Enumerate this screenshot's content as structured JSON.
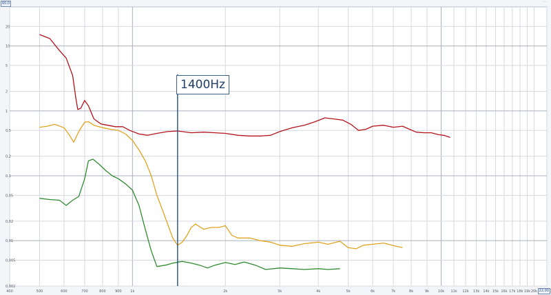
{
  "corners": {
    "top_left": "60,0",
    "bottom_right": "22,00"
  },
  "window_dots": "···",
  "marker": {
    "label": "1400Hz",
    "freq": 1400,
    "color": "#1f4e8c"
  },
  "chart_data": {
    "type": "line",
    "title": "",
    "xlabel": "",
    "ylabel": "",
    "x_scale": "log",
    "y_scale": "log",
    "xlim": [
      400,
      22000
    ],
    "ylim": [
      0.002,
      40
    ],
    "grid": true,
    "legend": "none",
    "x_ticks": [
      {
        "v": 400,
        "label": "400"
      },
      {
        "v": 500,
        "label": "500"
      },
      {
        "v": 600,
        "label": "600"
      },
      {
        "v": 700,
        "label": "700"
      },
      {
        "v": 800,
        "label": "800"
      },
      {
        "v": 900,
        "label": "900"
      },
      {
        "v": 1000,
        "label": "1k"
      },
      {
        "v": 2000,
        "label": "2k"
      },
      {
        "v": 3000,
        "label": "3k"
      },
      {
        "v": 4000,
        "label": "4k"
      },
      {
        "v": 5000,
        "label": "5k"
      },
      {
        "v": 6000,
        "label": "6k"
      },
      {
        "v": 7000,
        "label": "7k"
      },
      {
        "v": 8000,
        "label": "8k"
      },
      {
        "v": 9000,
        "label": "9k"
      },
      {
        "v": 10000,
        "label": "10k"
      },
      {
        "v": 11000,
        "label": "11k"
      },
      {
        "v": 12000,
        "label": "12k"
      },
      {
        "v": 13000,
        "label": "13k"
      },
      {
        "v": 14000,
        "label": "14k"
      },
      {
        "v": 15000,
        "label": "15k"
      },
      {
        "v": 16000,
        "label": "16k"
      },
      {
        "v": 17000,
        "label": "17k"
      },
      {
        "v": 18000,
        "label": "18k"
      },
      {
        "v": 19000,
        "label": "19k"
      },
      {
        "v": 20000,
        "label": "20k"
      },
      {
        "v": 22000,
        "label": "22,00"
      }
    ],
    "y_ticks": [
      {
        "v": 20,
        "label": "20"
      },
      {
        "v": 10,
        "label": "10"
      },
      {
        "v": 5,
        "label": "5"
      },
      {
        "v": 2,
        "label": "2"
      },
      {
        "v": 1,
        "label": "1"
      },
      {
        "v": 0.5,
        "label": "0,5"
      },
      {
        "v": 0.2,
        "label": "0,2"
      },
      {
        "v": 0.1,
        "label": "0,1"
      },
      {
        "v": 0.05,
        "label": "0,05"
      },
      {
        "v": 0.02,
        "label": "0,02"
      },
      {
        "v": 0.01,
        "label": "0,01"
      },
      {
        "v": 0.005,
        "label": "0,005"
      },
      {
        "v": 0.002,
        "label": "0,002"
      }
    ],
    "series": [
      {
        "color": "#b5121b",
        "points": [
          [
            500,
            15
          ],
          [
            540,
            13
          ],
          [
            580,
            8.5
          ],
          [
            610,
            6.5
          ],
          [
            640,
            3.5
          ],
          [
            655,
            1.6
          ],
          [
            665,
            1.05
          ],
          [
            680,
            1.1
          ],
          [
            700,
            1.45
          ],
          [
            720,
            1.2
          ],
          [
            750,
            0.75
          ],
          [
            790,
            0.63
          ],
          [
            830,
            0.6
          ],
          [
            880,
            0.57
          ],
          [
            930,
            0.57
          ],
          [
            980,
            0.5
          ],
          [
            1050,
            0.44
          ],
          [
            1120,
            0.42
          ],
          [
            1200,
            0.45
          ],
          [
            1300,
            0.48
          ],
          [
            1400,
            0.49
          ],
          [
            1550,
            0.46
          ],
          [
            1700,
            0.47
          ],
          [
            1850,
            0.46
          ],
          [
            2000,
            0.45
          ],
          [
            2200,
            0.42
          ],
          [
            2400,
            0.41
          ],
          [
            2600,
            0.41
          ],
          [
            2800,
            0.42
          ],
          [
            3000,
            0.48
          ],
          [
            3300,
            0.55
          ],
          [
            3600,
            0.6
          ],
          [
            3900,
            0.68
          ],
          [
            4200,
            0.78
          ],
          [
            4500,
            0.75
          ],
          [
            4800,
            0.72
          ],
          [
            5100,
            0.62
          ],
          [
            5400,
            0.5
          ],
          [
            5700,
            0.52
          ],
          [
            6000,
            0.58
          ],
          [
            6500,
            0.6
          ],
          [
            7000,
            0.56
          ],
          [
            7500,
            0.58
          ],
          [
            7900,
            0.52
          ],
          [
            8300,
            0.47
          ],
          [
            8800,
            0.46
          ],
          [
            9300,
            0.46
          ],
          [
            9800,
            0.43
          ],
          [
            10200,
            0.42
          ],
          [
            10700,
            0.39
          ]
        ]
      },
      {
        "color": "#e0a320",
        "points": [
          [
            500,
            0.56
          ],
          [
            530,
            0.58
          ],
          [
            560,
            0.62
          ],
          [
            600,
            0.55
          ],
          [
            625,
            0.42
          ],
          [
            645,
            0.33
          ],
          [
            670,
            0.48
          ],
          [
            700,
            0.67
          ],
          [
            720,
            0.68
          ],
          [
            750,
            0.6
          ],
          [
            800,
            0.55
          ],
          [
            850,
            0.52
          ],
          [
            900,
            0.5
          ],
          [
            950,
            0.44
          ],
          [
            1000,
            0.35
          ],
          [
            1050,
            0.25
          ],
          [
            1100,
            0.17
          ],
          [
            1150,
            0.1
          ],
          [
            1200,
            0.05
          ],
          [
            1250,
            0.03
          ],
          [
            1300,
            0.018
          ],
          [
            1350,
            0.011
          ],
          [
            1400,
            0.0085
          ],
          [
            1450,
            0.0095
          ],
          [
            1500,
            0.012
          ],
          [
            1550,
            0.016
          ],
          [
            1600,
            0.018
          ],
          [
            1700,
            0.015
          ],
          [
            1800,
            0.016
          ],
          [
            1900,
            0.016
          ],
          [
            2000,
            0.017
          ],
          [
            2100,
            0.012
          ],
          [
            2200,
            0.011
          ],
          [
            2400,
            0.011
          ],
          [
            2600,
            0.01
          ],
          [
            2800,
            0.0095
          ],
          [
            3000,
            0.0085
          ],
          [
            3300,
            0.0082
          ],
          [
            3600,
            0.009
          ],
          [
            4000,
            0.0095
          ],
          [
            4300,
            0.0088
          ],
          [
            4700,
            0.0098
          ],
          [
            5000,
            0.0078
          ],
          [
            5300,
            0.0075
          ],
          [
            5600,
            0.0085
          ],
          [
            6000,
            0.0088
          ],
          [
            6500,
            0.0092
          ],
          [
            7000,
            0.0084
          ],
          [
            7500,
            0.0078
          ]
        ]
      },
      {
        "color": "#2e8b2e",
        "points": [
          [
            500,
            0.045
          ],
          [
            540,
            0.043
          ],
          [
            580,
            0.042
          ],
          [
            610,
            0.035
          ],
          [
            640,
            0.042
          ],
          [
            670,
            0.048
          ],
          [
            700,
            0.09
          ],
          [
            720,
            0.17
          ],
          [
            745,
            0.18
          ],
          [
            780,
            0.15
          ],
          [
            820,
            0.12
          ],
          [
            860,
            0.1
          ],
          [
            900,
            0.09
          ],
          [
            950,
            0.075
          ],
          [
            1000,
            0.06
          ],
          [
            1050,
            0.035
          ],
          [
            1100,
            0.015
          ],
          [
            1150,
            0.007
          ],
          [
            1200,
            0.004
          ],
          [
            1280,
            0.0042
          ],
          [
            1350,
            0.0045
          ],
          [
            1450,
            0.0048
          ],
          [
            1550,
            0.0045
          ],
          [
            1650,
            0.0042
          ],
          [
            1750,
            0.0038
          ],
          [
            1850,
            0.0042
          ],
          [
            2000,
            0.0046
          ],
          [
            2150,
            0.0043
          ],
          [
            2300,
            0.0047
          ],
          [
            2500,
            0.0042
          ],
          [
            2700,
            0.0036
          ],
          [
            3000,
            0.0038
          ],
          [
            3300,
            0.0037
          ],
          [
            3600,
            0.0036
          ],
          [
            4000,
            0.0037
          ],
          [
            4300,
            0.0036
          ],
          [
            4700,
            0.0037
          ]
        ]
      }
    ]
  }
}
